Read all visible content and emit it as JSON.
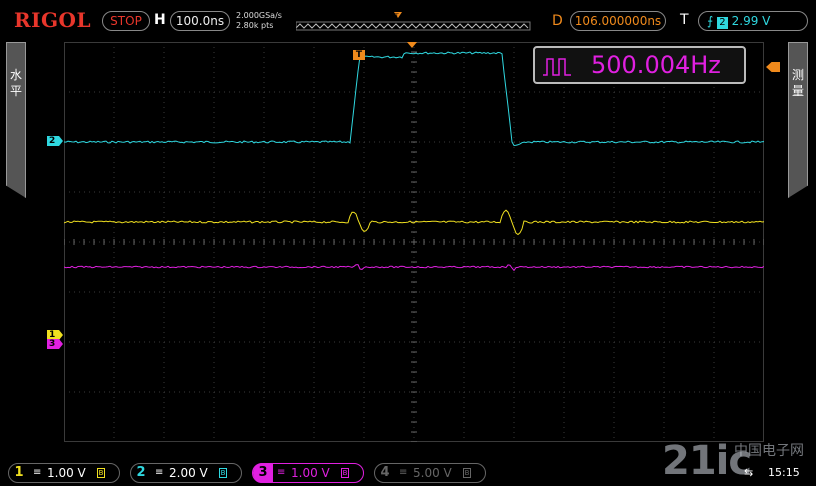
{
  "header": {
    "brand": "RIGOL",
    "run_state": "STOP",
    "timebase_label": "H",
    "timebase_value": "100.0ns",
    "sample_rate": "2.000GSa/s",
    "memory_depth": "2.80k pts",
    "delay_label": "D",
    "delay_value": "106.000000ns",
    "trigger_label": "T",
    "trigger_edge_icon": "rising-edge-icon",
    "trigger_source": "2",
    "trigger_level": "2.99 V"
  },
  "side_menus": {
    "left_label": "水平",
    "right_label": "测量"
  },
  "measurement": {
    "icon": "square-wave-icon",
    "value": "500.004Hz",
    "color": "#e020e0"
  },
  "channels": [
    {
      "num": "1",
      "coupling": "≡",
      "scale": "1.00 V",
      "color": "#f0e020",
      "active": true
    },
    {
      "num": "2",
      "coupling": "≡",
      "scale": "2.00 V",
      "color": "#2fd8e0",
      "active": true
    },
    {
      "num": "3",
      "coupling": "≡",
      "scale": "1.00 V",
      "color": "#e020e0",
      "active": true
    },
    {
      "num": "4",
      "coupling": "≡",
      "scale": "5.00 V",
      "color": "#666666",
      "active": false
    }
  ],
  "markers": {
    "ch1": "1",
    "ch2": "2",
    "ch3": "3",
    "trigger": "T"
  },
  "status": {
    "usb_icon": "usb-icon",
    "time": "15:15"
  },
  "watermark": {
    "text": "21ic",
    "subtext": "中国电子网"
  },
  "colors": {
    "grid": "#3a3a3a",
    "trigger": "#f08a1c",
    "brand": "#e8362b"
  }
}
